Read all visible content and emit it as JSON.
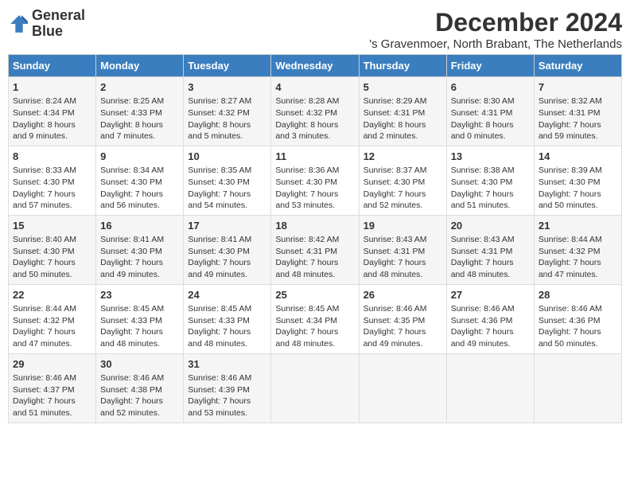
{
  "logo": {
    "line1": "General",
    "line2": "Blue"
  },
  "title": "December 2024",
  "subtitle": "'s Gravenmoer, North Brabant, The Netherlands",
  "days_of_week": [
    "Sunday",
    "Monday",
    "Tuesday",
    "Wednesday",
    "Thursday",
    "Friday",
    "Saturday"
  ],
  "weeks": [
    [
      {
        "day": "1",
        "sunrise": "Sunrise: 8:24 AM",
        "sunset": "Sunset: 4:34 PM",
        "daylight": "Daylight: 8 hours and 9 minutes."
      },
      {
        "day": "2",
        "sunrise": "Sunrise: 8:25 AM",
        "sunset": "Sunset: 4:33 PM",
        "daylight": "Daylight: 8 hours and 7 minutes."
      },
      {
        "day": "3",
        "sunrise": "Sunrise: 8:27 AM",
        "sunset": "Sunset: 4:32 PM",
        "daylight": "Daylight: 8 hours and 5 minutes."
      },
      {
        "day": "4",
        "sunrise": "Sunrise: 8:28 AM",
        "sunset": "Sunset: 4:32 PM",
        "daylight": "Daylight: 8 hours and 3 minutes."
      },
      {
        "day": "5",
        "sunrise": "Sunrise: 8:29 AM",
        "sunset": "Sunset: 4:31 PM",
        "daylight": "Daylight: 8 hours and 2 minutes."
      },
      {
        "day": "6",
        "sunrise": "Sunrise: 8:30 AM",
        "sunset": "Sunset: 4:31 PM",
        "daylight": "Daylight: 8 hours and 0 minutes."
      },
      {
        "day": "7",
        "sunrise": "Sunrise: 8:32 AM",
        "sunset": "Sunset: 4:31 PM",
        "daylight": "Daylight: 7 hours and 59 minutes."
      }
    ],
    [
      {
        "day": "8",
        "sunrise": "Sunrise: 8:33 AM",
        "sunset": "Sunset: 4:30 PM",
        "daylight": "Daylight: 7 hours and 57 minutes."
      },
      {
        "day": "9",
        "sunrise": "Sunrise: 8:34 AM",
        "sunset": "Sunset: 4:30 PM",
        "daylight": "Daylight: 7 hours and 56 minutes."
      },
      {
        "day": "10",
        "sunrise": "Sunrise: 8:35 AM",
        "sunset": "Sunset: 4:30 PM",
        "daylight": "Daylight: 7 hours and 54 minutes."
      },
      {
        "day": "11",
        "sunrise": "Sunrise: 8:36 AM",
        "sunset": "Sunset: 4:30 PM",
        "daylight": "Daylight: 7 hours and 53 minutes."
      },
      {
        "day": "12",
        "sunrise": "Sunrise: 8:37 AM",
        "sunset": "Sunset: 4:30 PM",
        "daylight": "Daylight: 7 hours and 52 minutes."
      },
      {
        "day": "13",
        "sunrise": "Sunrise: 8:38 AM",
        "sunset": "Sunset: 4:30 PM",
        "daylight": "Daylight: 7 hours and 51 minutes."
      },
      {
        "day": "14",
        "sunrise": "Sunrise: 8:39 AM",
        "sunset": "Sunset: 4:30 PM",
        "daylight": "Daylight: 7 hours and 50 minutes."
      }
    ],
    [
      {
        "day": "15",
        "sunrise": "Sunrise: 8:40 AM",
        "sunset": "Sunset: 4:30 PM",
        "daylight": "Daylight: 7 hours and 50 minutes."
      },
      {
        "day": "16",
        "sunrise": "Sunrise: 8:41 AM",
        "sunset": "Sunset: 4:30 PM",
        "daylight": "Daylight: 7 hours and 49 minutes."
      },
      {
        "day": "17",
        "sunrise": "Sunrise: 8:41 AM",
        "sunset": "Sunset: 4:30 PM",
        "daylight": "Daylight: 7 hours and 49 minutes."
      },
      {
        "day": "18",
        "sunrise": "Sunrise: 8:42 AM",
        "sunset": "Sunset: 4:31 PM",
        "daylight": "Daylight: 7 hours and 48 minutes."
      },
      {
        "day": "19",
        "sunrise": "Sunrise: 8:43 AM",
        "sunset": "Sunset: 4:31 PM",
        "daylight": "Daylight: 7 hours and 48 minutes."
      },
      {
        "day": "20",
        "sunrise": "Sunrise: 8:43 AM",
        "sunset": "Sunset: 4:31 PM",
        "daylight": "Daylight: 7 hours and 48 minutes."
      },
      {
        "day": "21",
        "sunrise": "Sunrise: 8:44 AM",
        "sunset": "Sunset: 4:32 PM",
        "daylight": "Daylight: 7 hours and 47 minutes."
      }
    ],
    [
      {
        "day": "22",
        "sunrise": "Sunrise: 8:44 AM",
        "sunset": "Sunset: 4:32 PM",
        "daylight": "Daylight: 7 hours and 47 minutes."
      },
      {
        "day": "23",
        "sunrise": "Sunrise: 8:45 AM",
        "sunset": "Sunset: 4:33 PM",
        "daylight": "Daylight: 7 hours and 48 minutes."
      },
      {
        "day": "24",
        "sunrise": "Sunrise: 8:45 AM",
        "sunset": "Sunset: 4:33 PM",
        "daylight": "Daylight: 7 hours and 48 minutes."
      },
      {
        "day": "25",
        "sunrise": "Sunrise: 8:45 AM",
        "sunset": "Sunset: 4:34 PM",
        "daylight": "Daylight: 7 hours and 48 minutes."
      },
      {
        "day": "26",
        "sunrise": "Sunrise: 8:46 AM",
        "sunset": "Sunset: 4:35 PM",
        "daylight": "Daylight: 7 hours and 49 minutes."
      },
      {
        "day": "27",
        "sunrise": "Sunrise: 8:46 AM",
        "sunset": "Sunset: 4:36 PM",
        "daylight": "Daylight: 7 hours and 49 minutes."
      },
      {
        "day": "28",
        "sunrise": "Sunrise: 8:46 AM",
        "sunset": "Sunset: 4:36 PM",
        "daylight": "Daylight: 7 hours and 50 minutes."
      }
    ],
    [
      {
        "day": "29",
        "sunrise": "Sunrise: 8:46 AM",
        "sunset": "Sunset: 4:37 PM",
        "daylight": "Daylight: 7 hours and 51 minutes."
      },
      {
        "day": "30",
        "sunrise": "Sunrise: 8:46 AM",
        "sunset": "Sunset: 4:38 PM",
        "daylight": "Daylight: 7 hours and 52 minutes."
      },
      {
        "day": "31",
        "sunrise": "Sunrise: 8:46 AM",
        "sunset": "Sunset: 4:39 PM",
        "daylight": "Daylight: 7 hours and 53 minutes."
      },
      null,
      null,
      null,
      null
    ]
  ]
}
